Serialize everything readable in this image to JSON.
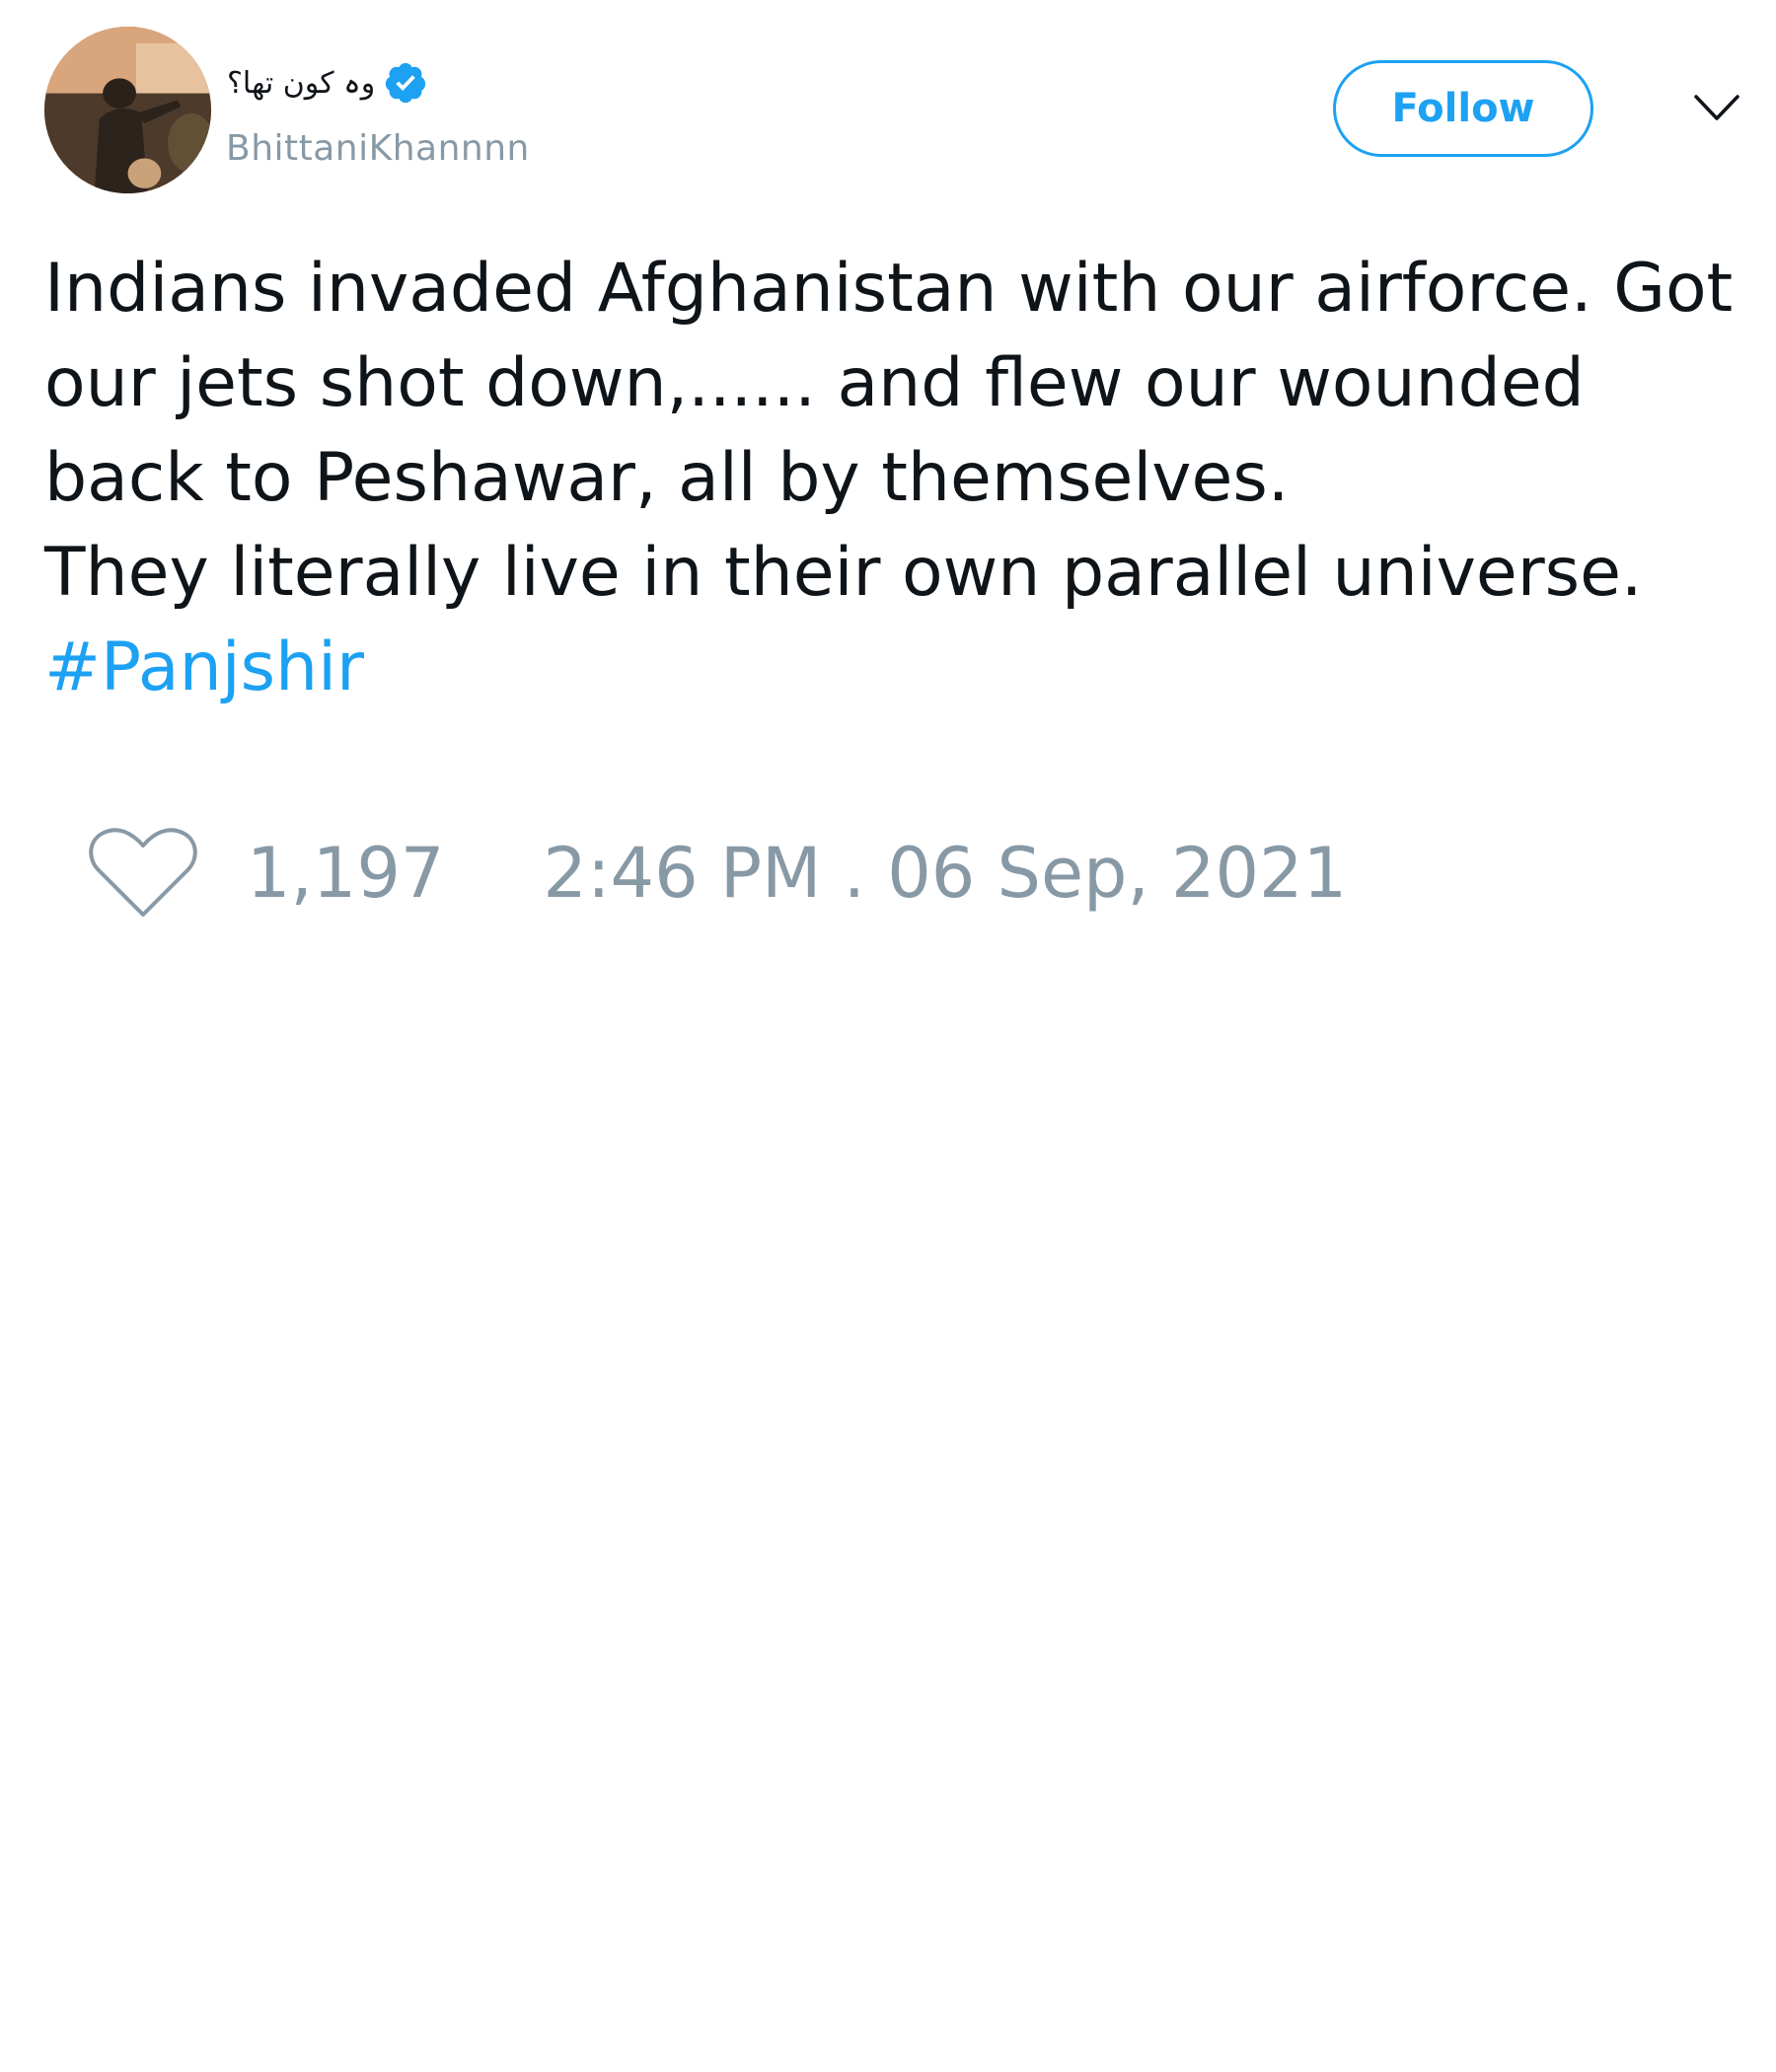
{
  "user": {
    "display_name": "وہ کون تھا؟",
    "handle": "BhittaniKhannnn",
    "verified": true,
    "avatar_icon": "profile-photo"
  },
  "actions": {
    "follow_label": "Follow",
    "menu_icon": "chevron-down-icon"
  },
  "tweet": {
    "lines": [
      "Indians invaded Afghanistan with our airforce. Got",
      "our jets shot down,...... and flew our wounded",
      "back to Peshawar, all by themselves.",
      "They literally live in their own parallel universe."
    ],
    "hashtag": "#Panjshir"
  },
  "footer": {
    "like_icon": "heart-icon",
    "like_count": "1,197",
    "timestamp": "2:46 PM . 06 Sep, 2021"
  },
  "colors": {
    "accent": "#1da1f2",
    "muted": "#8899a6",
    "text": "#0f1419"
  }
}
